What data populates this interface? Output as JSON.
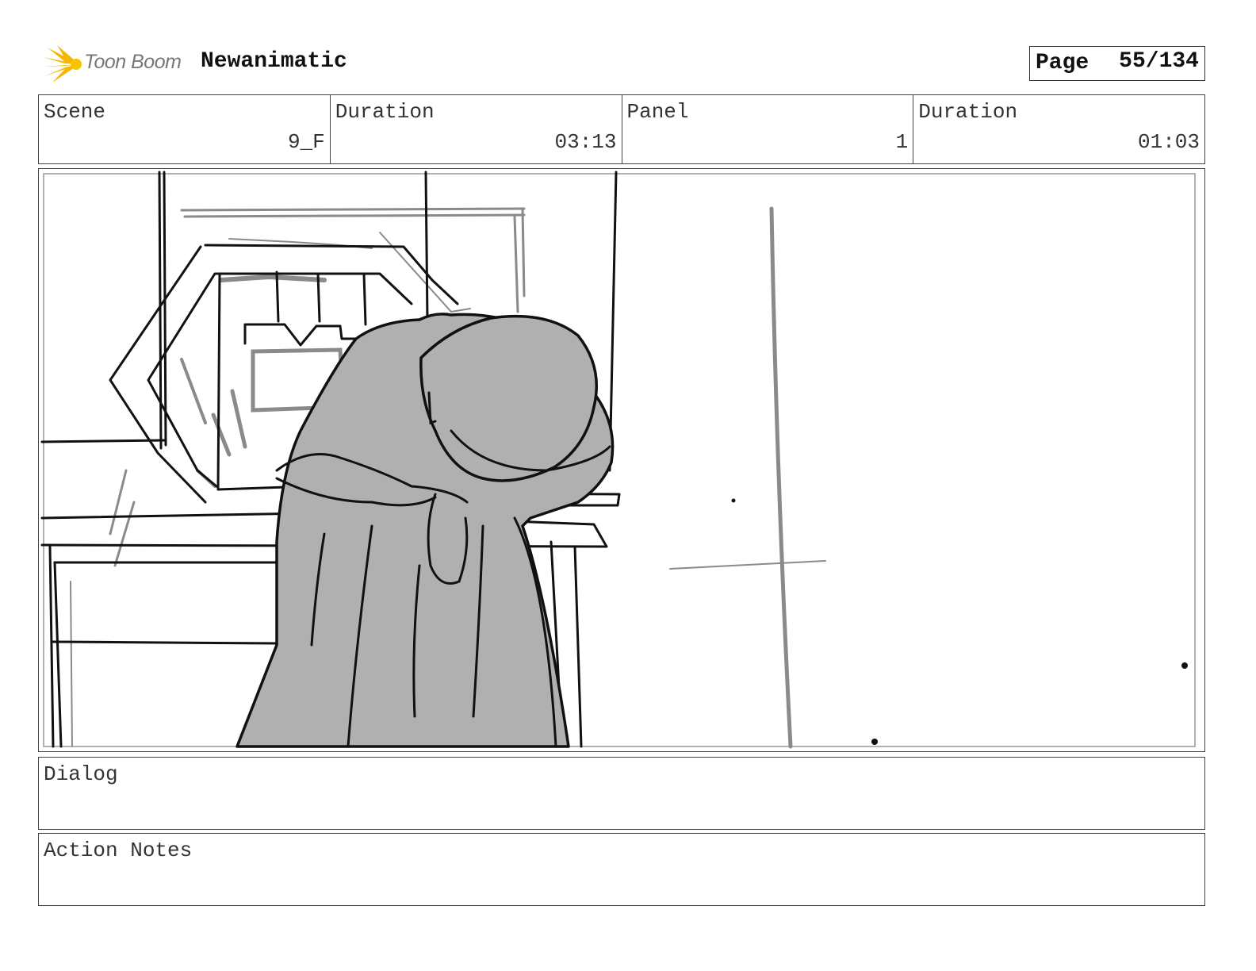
{
  "header": {
    "logo_text": "Toon Boom",
    "project_title": "Newanimatic",
    "page_label": "Page",
    "page_value": "55/134"
  },
  "info": {
    "scene_label": "Scene",
    "scene_value": "9_F",
    "scene_duration_label": "Duration",
    "scene_duration_value": "03:13",
    "panel_label": "Panel",
    "panel_value": "1",
    "panel_duration_label": "Duration",
    "panel_duration_value": "01:03"
  },
  "panel": {
    "image": "storyboard-sketch",
    "colors": {
      "line": "#111111",
      "rough": "#8a8a8a",
      "fill": "#b0b0b0"
    }
  },
  "dialog": {
    "label": "Dialog"
  },
  "action_notes": {
    "label": "Action Notes"
  }
}
